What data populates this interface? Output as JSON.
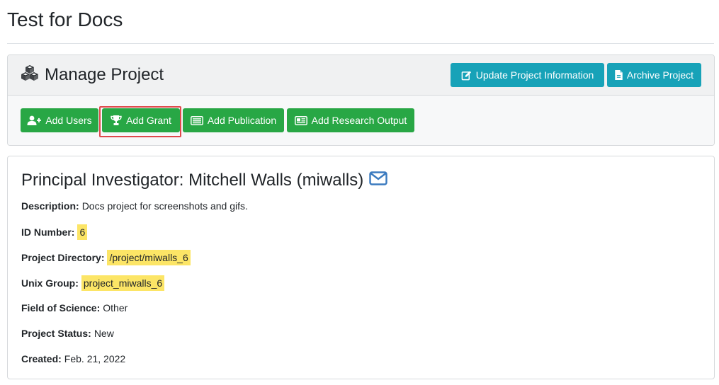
{
  "page": {
    "title": "Test for Docs"
  },
  "manage": {
    "title": "Manage Project",
    "title_icon": "cubes-icon",
    "header_buttons": [
      {
        "label": "Update Project Information",
        "icon": "edit-icon"
      },
      {
        "label": "Archive Project",
        "icon": "file-icon"
      }
    ],
    "action_buttons": [
      {
        "label": "Add Users",
        "icon": "user-plus-icon"
      },
      {
        "label": "Add Grant",
        "icon": "trophy-icon"
      },
      {
        "label": "Add Publication",
        "icon": "newspaper-icon"
      },
      {
        "label": "Add Research Output",
        "icon": "research-output-icon"
      }
    ]
  },
  "project": {
    "pi_heading": "Principal Investigator: Mitchell Walls (miwalls)",
    "fields": [
      {
        "label": "Description:",
        "value": "Docs project for screenshots and gifs.",
        "highlight": false
      },
      {
        "label": "ID Number:",
        "value": "6",
        "highlight": true
      },
      {
        "label": "Project Directory:",
        "value": "/project/miwalls_6",
        "highlight": true
      },
      {
        "label": "Unix Group:",
        "value": "project_miwalls_6",
        "highlight": true
      },
      {
        "label": "Field of Science:",
        "value": "Other",
        "highlight": false
      },
      {
        "label": "Project Status:",
        "value": "New",
        "highlight": false
      },
      {
        "label": "Created:",
        "value": "Feb. 21, 2022",
        "highlight": false
      }
    ]
  },
  "colors": {
    "info": "#17a2b8",
    "success": "#28a745",
    "highlight": "#fce566",
    "annotation_border": "#e0484b",
    "mail_icon": "#3a7abf"
  }
}
